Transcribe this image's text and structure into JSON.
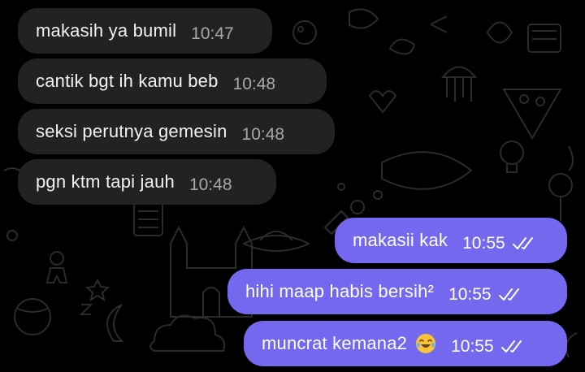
{
  "chat": {
    "incoming": [
      {
        "text": "makasih ya bumil",
        "time": "10:47"
      },
      {
        "text": "cantik bgt ih kamu beb",
        "time": "10:48"
      },
      {
        "text": "seksi perutnya gemesin",
        "time": "10:48"
      },
      {
        "text": "pgn ktm tapi jauh",
        "time": "10:48"
      }
    ],
    "outgoing": [
      {
        "text": "makasii kak",
        "time": "10:55",
        "status": "read"
      },
      {
        "text": "hihi maap habis bersih²",
        "time": "10:55",
        "status": "read"
      },
      {
        "text": "muncrat kemana2",
        "emoji": "face-with-tears-of-joy",
        "time": "10:55",
        "status": "read"
      }
    ]
  },
  "colors": {
    "background": "#000000",
    "incoming_bubble": "#222222",
    "outgoing_bubble": "#7468ee",
    "doodle": "#2e2e2e"
  }
}
